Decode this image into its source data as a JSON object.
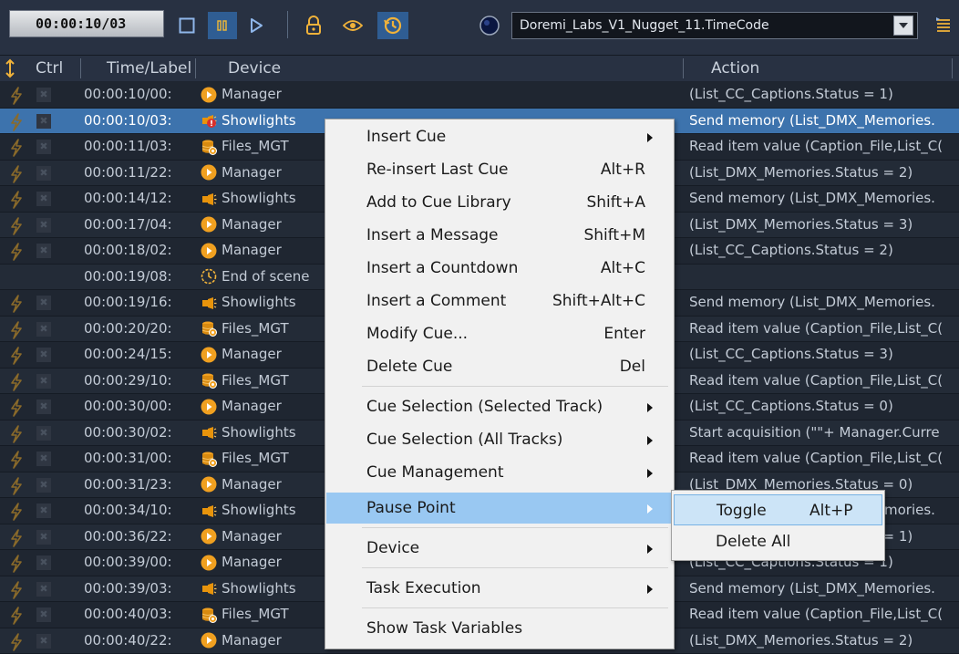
{
  "toolbar": {
    "timecode": "00:00:10/03",
    "source": "Doremi_Labs_V1_Nugget_11.TimeCode",
    "icons": [
      "stop-icon",
      "pause-icon",
      "play-icon",
      "lock-icon",
      "eye-icon",
      "history-icon",
      "status-orb-icon",
      "list-icon"
    ]
  },
  "columns": {
    "ctrl": "Ctrl",
    "time": "Time/Label",
    "device": "Device",
    "action": "Action"
  },
  "rows": [
    {
      "time": "00:00:10/00:",
      "device": "Manager",
      "icon": "manager",
      "action": "(List_CC_Captions.Status = 1)"
    },
    {
      "time": "00:00:10/03:",
      "device": "Showlights",
      "icon": "showlights-error",
      "action": "Send memory (List_DMX_Memories.",
      "selected": true
    },
    {
      "time": "00:00:11/03:",
      "device": "Files_MGT",
      "icon": "files",
      "action": "Read item value (Caption_File,List_C("
    },
    {
      "time": "00:00:11/22:",
      "device": "Manager",
      "icon": "manager",
      "action": "(List_DMX_Memories.Status = 2)"
    },
    {
      "time": "00:00:14/12:",
      "device": "Showlights",
      "icon": "showlights",
      "action": "Send memory (List_DMX_Memories."
    },
    {
      "time": "00:00:17/04:",
      "device": "Manager",
      "icon": "manager",
      "action": "(List_DMX_Memories.Status = 3)"
    },
    {
      "time": "00:00:18/02:",
      "device": "Manager",
      "icon": "manager",
      "action": "(List_CC_Captions.Status = 2)"
    },
    {
      "time": "00:00:19/08:",
      "device": "End of scene",
      "icon": "clock",
      "action": "",
      "nomark": true
    },
    {
      "time": "00:00:19/16:",
      "device": "Showlights",
      "icon": "showlights",
      "action": "Send memory (List_DMX_Memories."
    },
    {
      "time": "00:00:20/20:",
      "device": "Files_MGT",
      "icon": "files",
      "action": "Read item value (Caption_File,List_C("
    },
    {
      "time": "00:00:24/15:",
      "device": "Manager",
      "icon": "manager",
      "action": "(List_CC_Captions.Status = 3)"
    },
    {
      "time": "00:00:29/10:",
      "device": "Files_MGT",
      "icon": "files",
      "action": "Read item value (Caption_File,List_C("
    },
    {
      "time": "00:00:30/00:",
      "device": "Manager",
      "icon": "manager",
      "action": "(List_CC_Captions.Status = 0)"
    },
    {
      "time": "00:00:30/02:",
      "device": "Showlights",
      "icon": "showlights",
      "action": "Start acquisition (\"\"+ Manager.Curre"
    },
    {
      "time": "00:00:31/00:",
      "device": "Files_MGT",
      "icon": "files",
      "action": "Read item value (Caption_File,List_C("
    },
    {
      "time": "00:00:31/23:",
      "device": "Manager",
      "icon": "manager",
      "action": "(List_DMX_Memories.Status = 0)"
    },
    {
      "time": "00:00:34/10:",
      "device": "Showlights",
      "icon": "showlights",
      "action": "Send memory (List_DMX_Memories."
    },
    {
      "time": "00:00:36/22:",
      "device": "Manager",
      "icon": "manager",
      "action": "(List_DMX_Memories.Status = 1)"
    },
    {
      "time": "00:00:39/00:",
      "device": "Manager",
      "icon": "manager",
      "action": "(List_CC_Captions.Status = 1)"
    },
    {
      "time": "00:00:39/03:",
      "device": "Showlights",
      "icon": "showlights",
      "action": "Send memory (List_DMX_Memories."
    },
    {
      "time": "00:00:40/03:",
      "device": "Files_MGT",
      "icon": "files",
      "action": "Read item value (Caption_File,List_C("
    },
    {
      "time": "00:00:40/22:",
      "device": "Manager",
      "icon": "manager",
      "action": "(List_DMX_Memories.Status = 2)"
    }
  ],
  "context_menu": [
    {
      "label": "Insert Cue",
      "submenu": true
    },
    {
      "label": "Re-insert Last Cue",
      "shortcut": "Alt+R"
    },
    {
      "label": "Add to Cue Library",
      "shortcut": "Shift+A"
    },
    {
      "label": "Insert a Message",
      "shortcut": "Shift+M"
    },
    {
      "label": "Insert a Countdown",
      "shortcut": "Alt+C"
    },
    {
      "label": "Insert a Comment",
      "shortcut": "Shift+Alt+C"
    },
    {
      "label": "Modify Cue...",
      "shortcut": "Enter"
    },
    {
      "label": "Delete Cue",
      "shortcut": "Del"
    },
    {
      "label": "Cue Selection (Selected Track)",
      "submenu": true
    },
    {
      "label": "Cue Selection (All Tracks)",
      "submenu": true
    },
    {
      "label": "Cue Management",
      "submenu": true
    },
    {
      "label": "Pause Point",
      "submenu": true,
      "highlighted": true
    },
    {
      "label": "Device",
      "submenu": true
    },
    {
      "label": "Task Execution",
      "submenu": true
    },
    {
      "label": "Show Task Variables"
    }
  ],
  "submenu": [
    {
      "label": "Toggle",
      "shortcut": "Alt+P",
      "highlighted": true
    },
    {
      "label": "Delete All"
    }
  ],
  "colors": {
    "background": "#1e2530",
    "selected_row": "#3d73ad",
    "menu_highlight": "#99c8f2",
    "submenu_highlight": "#cce4f7",
    "manager_orange": "#f0a020",
    "showlights_orange": "#e8940c",
    "error_red": "#d9302c"
  }
}
